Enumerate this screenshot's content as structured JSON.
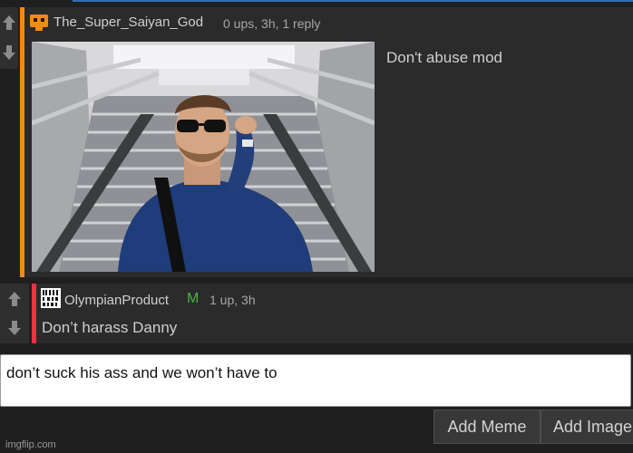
{
  "comments": [
    {
      "username": "The_Super_Saiyan_God",
      "meta": "0 ups, 3h, 1 reply",
      "text": "Don't abuse mod",
      "image_alt": "man in sunglasses on subway stairs"
    },
    {
      "username": "OlympianProduct",
      "badge": "M",
      "meta": "1 up, 3h",
      "text": "Don’t harass Danny"
    }
  ],
  "reply_box": {
    "value": "don’t suck his ass and we won’t have to"
  },
  "buttons": {
    "add_meme": "Add Meme",
    "add_image": "Add Image"
  },
  "watermark": "imgflip.com",
  "colors": {
    "accent_orange": "#f28b13",
    "accent_red": "#ef3340",
    "mod_green": "#47b646",
    "background": "#1f1f1f"
  },
  "icons": [
    "upvote-arrow-icon",
    "downvote-arrow-icon",
    "orange-avatar-icon",
    "qr-avatar-icon"
  ]
}
